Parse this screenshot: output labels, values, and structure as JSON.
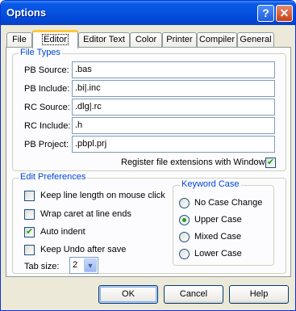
{
  "window": {
    "title": "Options",
    "help_glyph": "?",
    "close_glyph": "✕"
  },
  "tabs": [
    "File",
    "Editor",
    "Editor Text",
    "Color",
    "Printer",
    "Compiler",
    "General"
  ],
  "file_types": {
    "title": "File Types",
    "fields": [
      {
        "label": "PB Source:",
        "value": ".bas"
      },
      {
        "label": "PB Include:",
        "value": ".bi|.inc"
      },
      {
        "label": "RC Source:",
        "value": ".dlg|.rc"
      },
      {
        "label": "RC Include:",
        "value": ".h"
      },
      {
        "label": "PB Project:",
        "value": ".pbpl.prj"
      }
    ],
    "register_label": "Register file extensions with Windows",
    "register_checked": true
  },
  "edit_prefs": {
    "title": "Edit Preferences",
    "checks": [
      {
        "label": "Keep line length on mouse click",
        "checked": false
      },
      {
        "label": "Wrap caret at line ends",
        "checked": false
      },
      {
        "label": "Auto indent",
        "checked": true
      },
      {
        "label": "Keep Undo after save",
        "checked": false
      }
    ],
    "tab_size_label": "Tab size:",
    "tab_size_value": "2",
    "keyword_case": {
      "title": "Keyword Case",
      "options": [
        {
          "label": "No Case Change",
          "checked": false
        },
        {
          "label": "Upper Case",
          "checked": true
        },
        {
          "label": "Mixed Case",
          "checked": false
        },
        {
          "label": "Lower Case",
          "checked": false
        }
      ]
    }
  },
  "buttons": {
    "ok": "OK",
    "cancel": "Cancel",
    "help": "Help"
  },
  "colors": {
    "titlebar": "#0553e1",
    "group_title": "#0046d5",
    "tab_highlight": "#ffc83c",
    "check": "#21a121"
  }
}
